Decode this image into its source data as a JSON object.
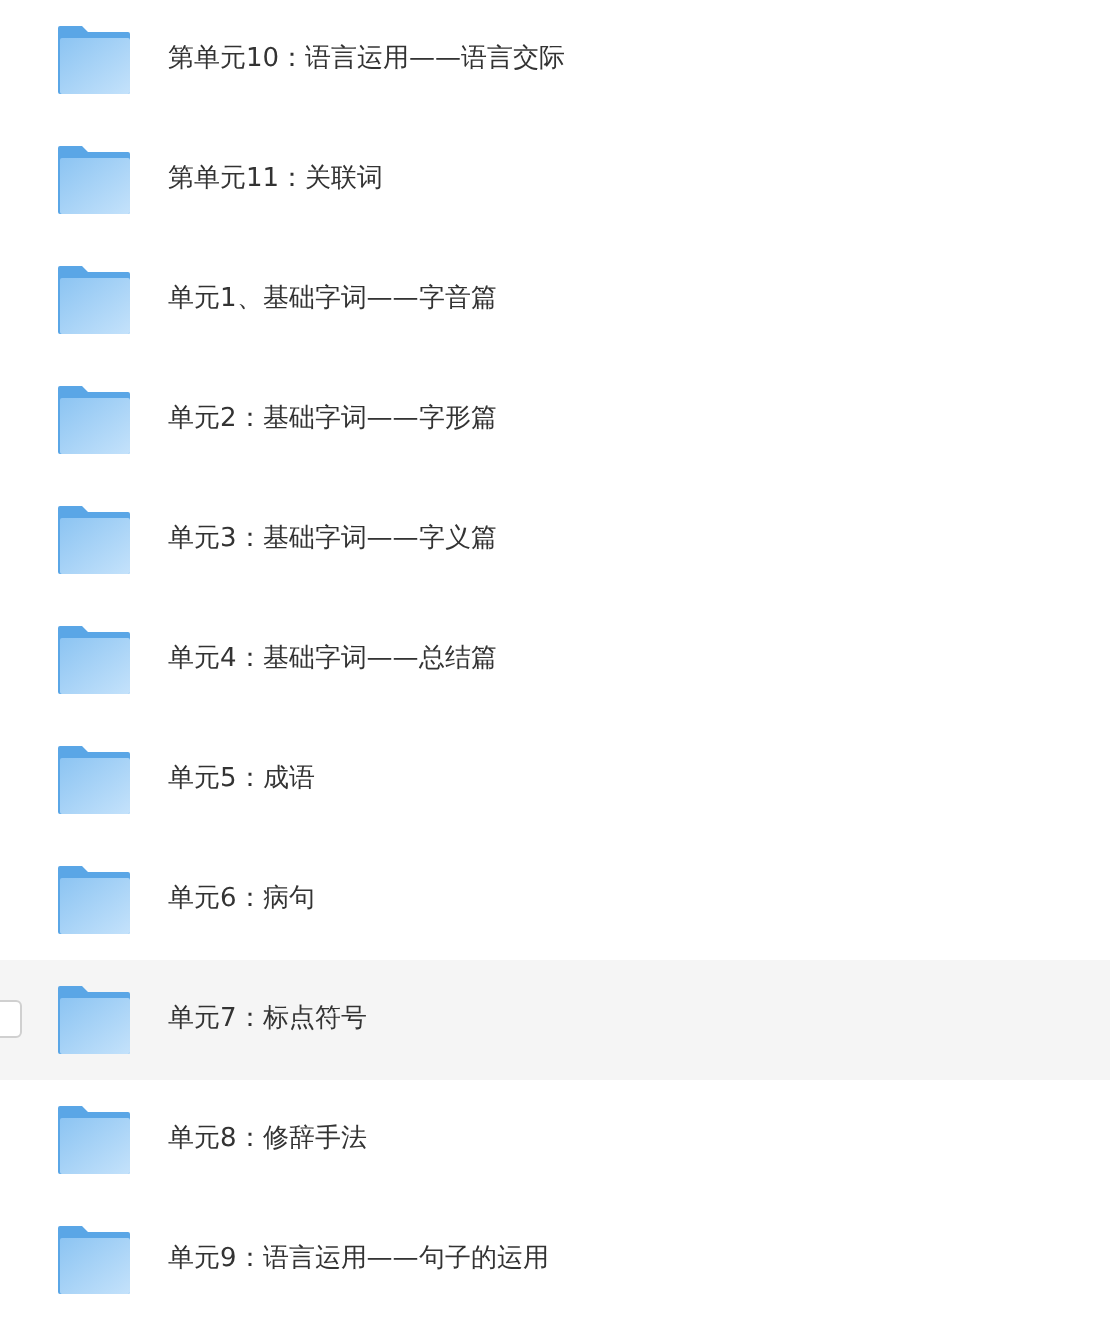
{
  "folders": [
    {
      "name": "第单元10：语言运用——语言交际",
      "hovered": false
    },
    {
      "name": "第单元11：关联词",
      "hovered": false
    },
    {
      "name": "单元1、基础字词——字音篇",
      "hovered": false
    },
    {
      "name": "单元2：基础字词——字形篇",
      "hovered": false
    },
    {
      "name": "单元3：基础字词——字义篇",
      "hovered": false
    },
    {
      "name": "单元4：基础字词——总结篇",
      "hovered": false
    },
    {
      "name": "单元5：成语",
      "hovered": false
    },
    {
      "name": "单元6：病句",
      "hovered": false
    },
    {
      "name": "单元7：标点符号",
      "hovered": true
    },
    {
      "name": "单元8：修辞手法",
      "hovered": false
    },
    {
      "name": "单元9：语言运用——句子的运用",
      "hovered": false
    }
  ]
}
